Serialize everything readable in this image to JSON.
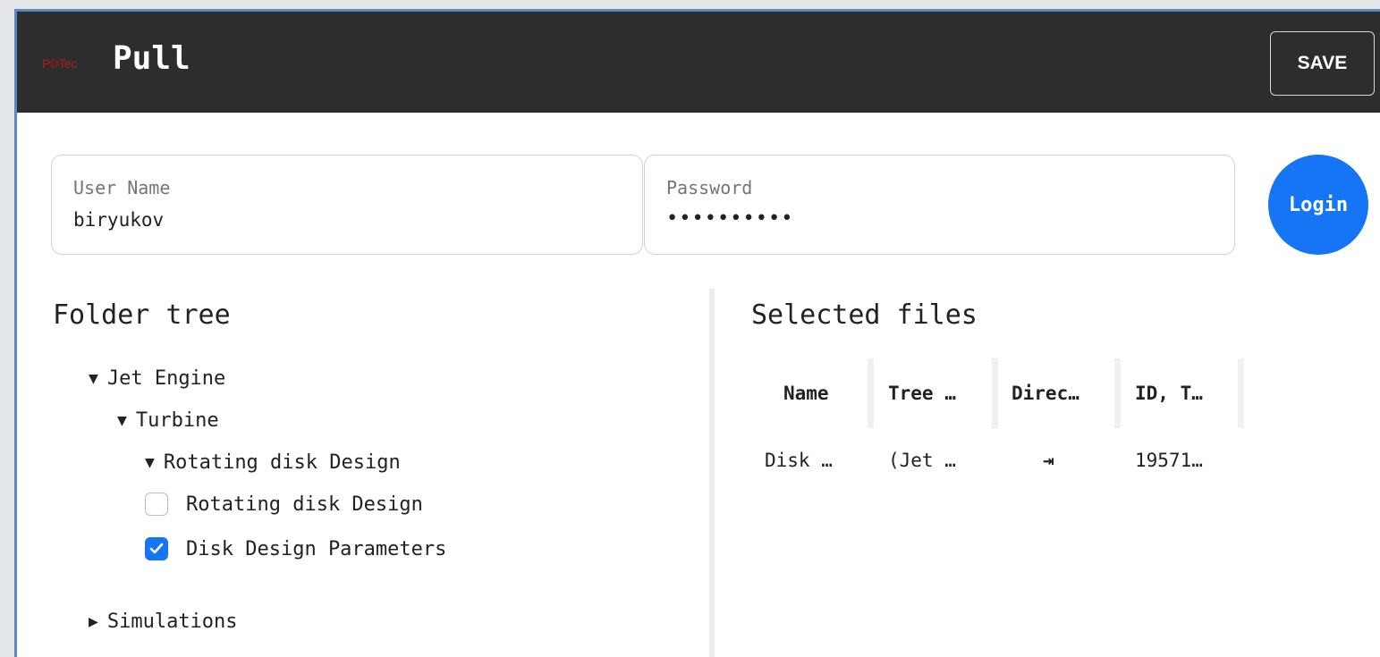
{
  "header": {
    "logo_left": "P",
    "logo_mid": "D",
    "logo_right": "Tec",
    "title": "Pull",
    "save_label": "SAVE"
  },
  "login": {
    "username_label": "User Name",
    "username_value": "biryukov",
    "password_label": "Password",
    "password_value": "••••••••••",
    "login_label": "Login"
  },
  "folder_tree": {
    "title": "Folder tree",
    "nodes": [
      {
        "label": "Jet Engine",
        "expander": "▼"
      },
      {
        "label": "Turbine",
        "expander": "▼"
      },
      {
        "label": "Rotating disk Design",
        "expander": "▼"
      },
      {
        "label": "Rotating disk Design",
        "checked": false
      },
      {
        "label": "Disk Design Parameters",
        "checked": true
      },
      {
        "label": "Simulations",
        "expander": "▶"
      }
    ]
  },
  "selected_files": {
    "title": "Selected files",
    "columns": [
      "Name",
      "Tree …",
      "Direc…",
      "ID, T…"
    ],
    "rows": [
      {
        "name": "Disk …",
        "tree": "(Jet …",
        "direction_icon": "⇥",
        "id": "19571…"
      }
    ]
  },
  "colors": {
    "header_bg": "#2d2d2d",
    "accent": "#1575f5",
    "frame_border": "#5b87c5"
  }
}
